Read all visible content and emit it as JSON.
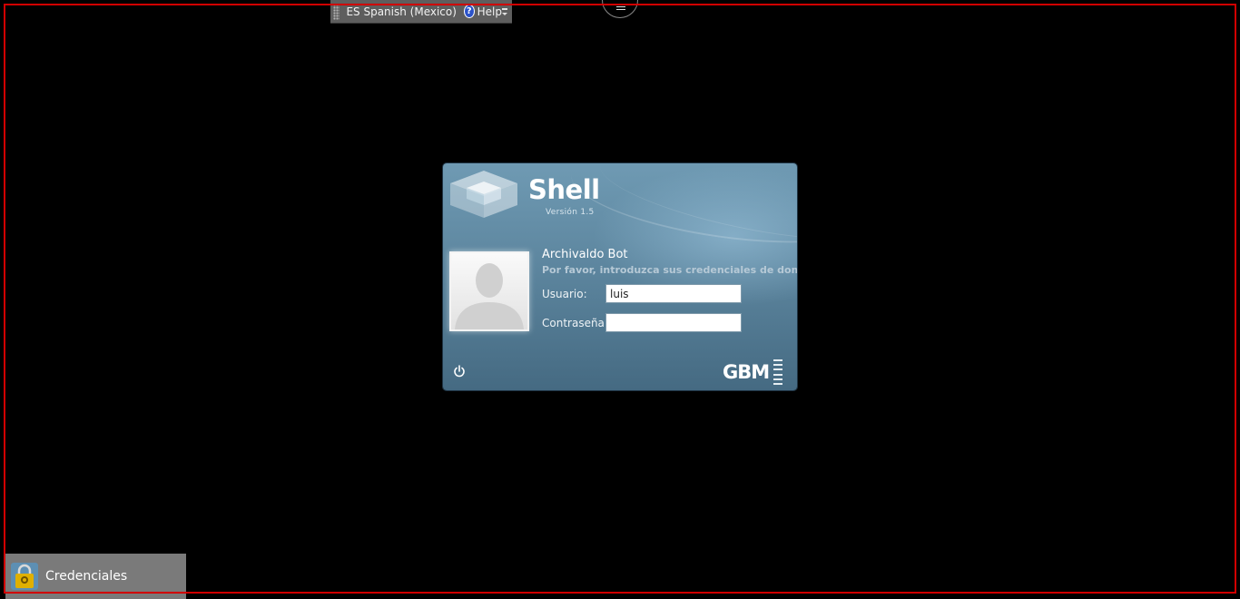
{
  "language_bar": {
    "language": "ES Spanish (Mexico)",
    "help_label": "Help"
  },
  "login_dialog": {
    "brand": "Shell",
    "version": "Versión 1.5",
    "user_name": "Archivaldo Bot",
    "prompt": "Por favor, introduzca sus credenciales de dominio",
    "username_label": "Usuario:",
    "username_value": "luis",
    "password_label": "Contraseña:",
    "password_value": "",
    "company_logo": "GBM"
  },
  "taskbar": {
    "credentials_label": "Credenciales"
  },
  "colors": {
    "frame": "#d00000",
    "dialog_top": "#6f9ab3",
    "dialog_bottom": "#456a82",
    "prompt_text": "#b6c9d6",
    "tile_bg": "#7a7a7a"
  },
  "icons": {
    "language_bar_grip": "grip-icon",
    "help": "help-icon",
    "language_bar_options": "options-icon",
    "brand_mark": "shell-logo-icon",
    "avatar": "user-avatar-icon",
    "power": "power-icon",
    "credentials": "lock-icon"
  }
}
